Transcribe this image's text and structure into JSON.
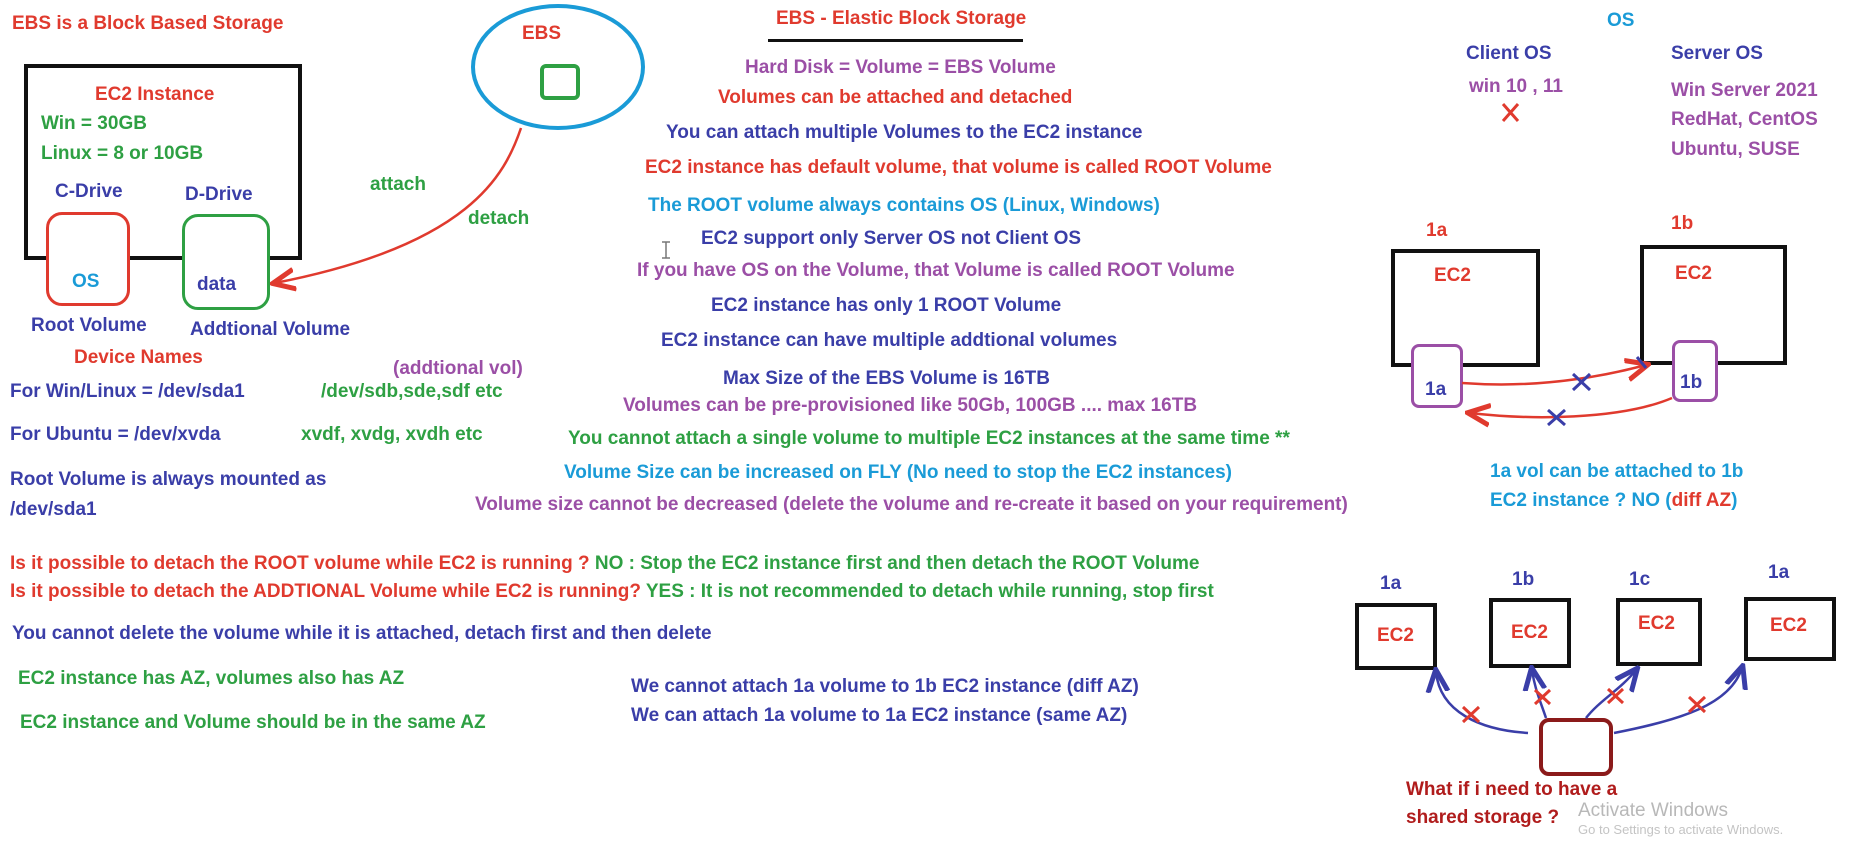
{
  "left": {
    "heading": "EBS is a Block Based Storage",
    "ec2_title": "EC2 Instance",
    "win_size": "Win = 30GB",
    "linux_size": "Linux = 8 or 10GB",
    "c_drive": "C-Drive",
    "d_drive": "D-Drive",
    "os_label": "OS",
    "data_label": "data",
    "root_volume": "Root Volume",
    "additional_volume": "Addtional Volume",
    "ebs_label": "EBS",
    "attach": "attach",
    "detach": "detach",
    "device_names": "Device Names",
    "addtional_vol": "(addtional vol)",
    "win_linux_dev": "For Win/Linux =  /dev/sda1",
    "win_linux_extra": "/dev/sdb,sde,sdf etc",
    "ubuntu_dev": "For Ubuntu = /dev/xvda",
    "ubuntu_extra": "xvdf, xvdg, xvdh etc",
    "root_mounted_1": "Root Volume is always mounted as",
    "root_mounted_2": "/dev/sda1"
  },
  "center": {
    "title": "EBS - Elastic Block Storage",
    "lines": [
      "Hard Disk = Volume = EBS Volume",
      "Volumes can be attached and detached",
      "You can attach multiple Volumes to the EC2 instance",
      "EC2 instance has default volume, that volume is called ROOT Volume",
      "The ROOT volume always contains OS (Linux, Windows)",
      "EC2 support only Server OS not Client OS",
      "If you have OS on the Volume, that Volume is called ROOT Volume",
      "EC2 instance has only 1 ROOT Volume",
      "EC2 instance can have multiple addtional volumes",
      "Max Size of the EBS Volume is 16TB",
      "Volumes can be pre-provisioned like 50Gb, 100GB .... max 16TB",
      "You cannot attach a single volume to multiple EC2 instances at the same time **",
      "Volume Size can be increased on FLY (No need to stop the EC2 instances)",
      "Volume size cannot be decreased (delete the volume and re-create it based on your requirement)"
    ]
  },
  "questions": {
    "q1": "Is it possible to detach the ROOT volume while EC2 is running ?",
    "a1": " NO : Stop the EC2 instance first and then detach the ROOT Volume",
    "q2": "Is it possible to detach the ADDTIONAL Volume while EC2 is running?",
    "a2": " YES : It is not recommended to detach while running, stop first",
    "delete_note": "You cannot delete the volume while it is attached, detach first and then delete",
    "az_note_1": "EC2 instance has AZ, volumes also has AZ",
    "az_note_2": "EC2 instance and Volume should be in the same AZ",
    "az_rule_1": "We cannot attach 1a volume to 1b EC2 instance (diff AZ)",
    "az_rule_2": "We can attach 1a volume to 1a EC2 instance (same AZ)"
  },
  "os_section": {
    "title": "OS",
    "client_os": "Client OS",
    "client_versions": "win 10 , 11",
    "server_os": "Server OS",
    "server_1": "Win Server 2021",
    "server_2": "RedHat, CentOS",
    "server_3": "Ubuntu, SUSE"
  },
  "az_diagram": {
    "az_left": "1a",
    "az_right": "1b",
    "ec2_left": "EC2",
    "ec2_right": "EC2",
    "vol_left": "1a",
    "vol_right": "1b",
    "caption_1": "1a vol can be attached to 1b",
    "caption_2a": "EC2 instance ? NO (",
    "caption_2b": "diff AZ",
    "caption_2c": ")"
  },
  "shared": {
    "az_labels": [
      "1a",
      "1b",
      "1c",
      "1a"
    ],
    "ec2_labels": [
      "EC2",
      "EC2",
      "EC2",
      "EC2"
    ],
    "question_1": "What if i need to have a",
    "question_2": "shared storage ?"
  },
  "watermark": {
    "line1": "Activate Windows",
    "line2": "Go to Settings to activate Windows."
  },
  "colors": {
    "red": "#e03a2e",
    "green": "#2ea043",
    "navy": "#3a3ea8",
    "blue": "#1a9bd7",
    "purple": "#9b4fa6",
    "dark_red": "#b01c1c"
  }
}
